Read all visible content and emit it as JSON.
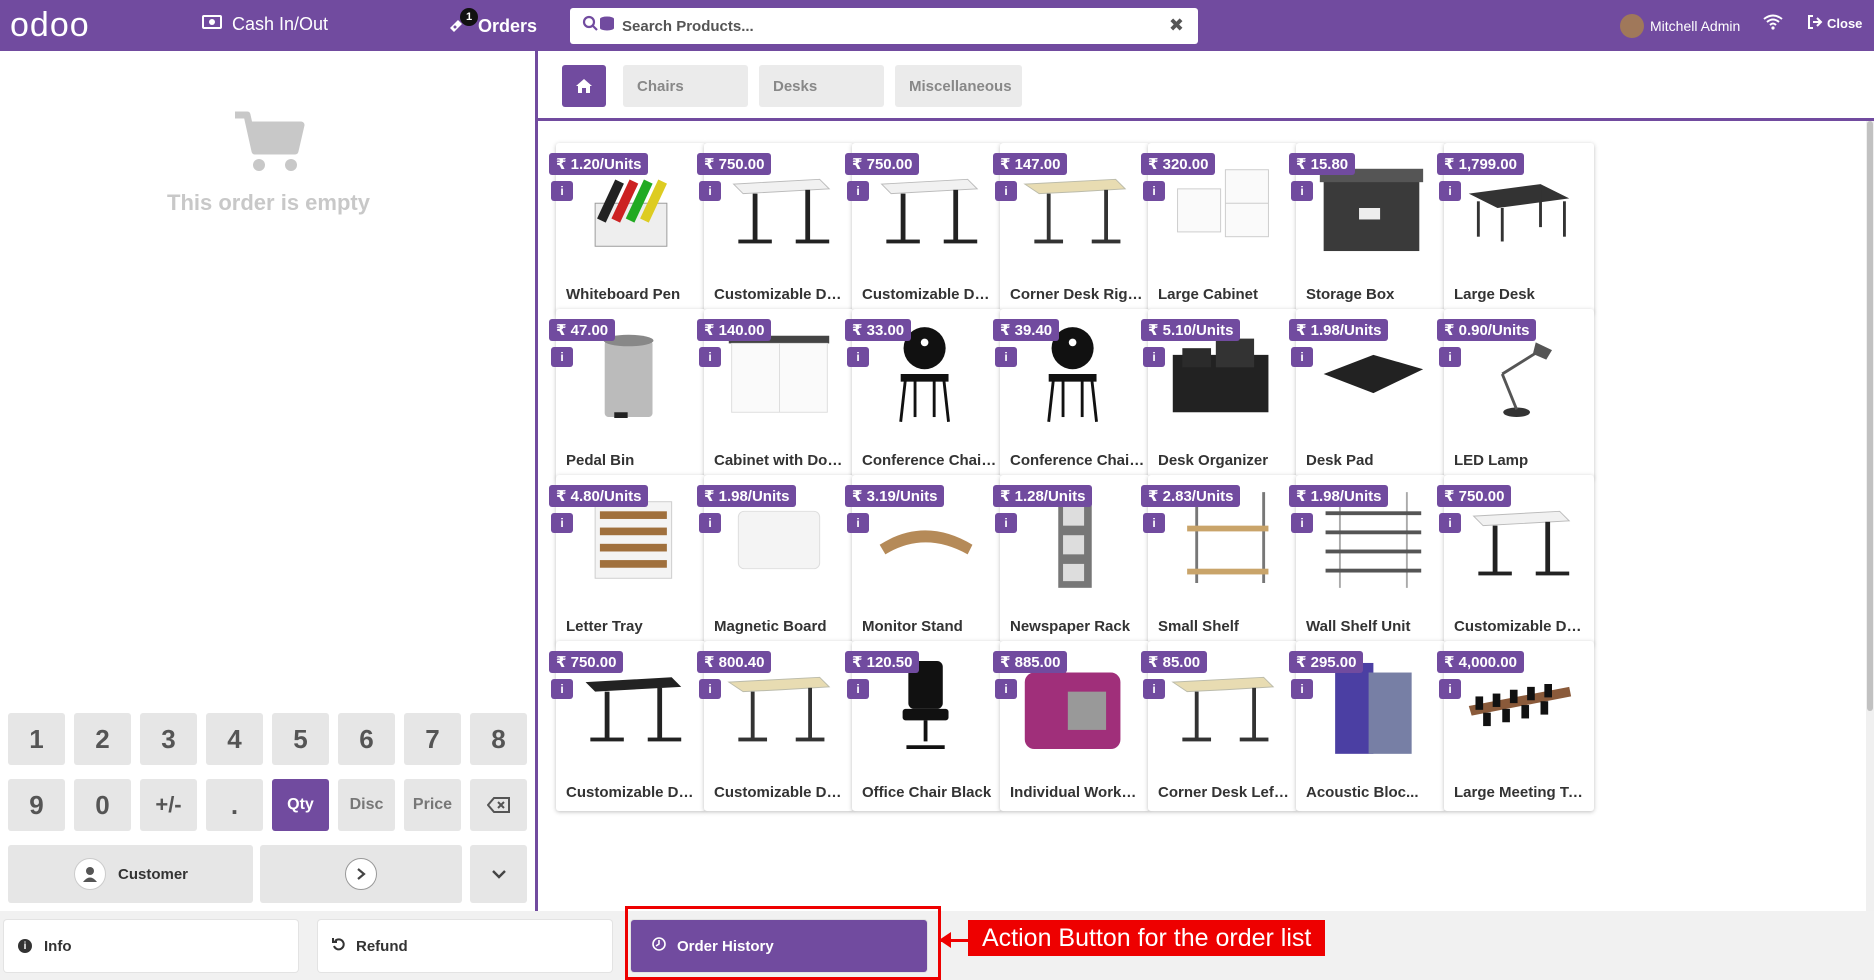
{
  "topbar": {
    "logo": "odoo",
    "cash_label": "Cash In/Out",
    "orders_label": "Orders",
    "orders_badge": "1",
    "search_placeholder": "Search Products...",
    "user_name": "Mitchell Admin",
    "close_label": "Close",
    "accent": "#714B9F"
  },
  "order": {
    "empty_text": "This order is empty"
  },
  "numpad": {
    "row1": [
      "1",
      "2",
      "3",
      "4",
      "5",
      "6",
      "7",
      "8"
    ],
    "row2": [
      "9",
      "0",
      "+/-",
      ".",
      "Qty",
      "Disc",
      "Price"
    ],
    "customer_label": "Customer"
  },
  "categories": [
    "Chairs",
    "Desks",
    "Miscellaneous"
  ],
  "products": [
    {
      "name": "Whiteboard Pen",
      "price": "₹ 1.20/Units",
      "img": "pens"
    },
    {
      "name": "Customizable Des...",
      "price": "₹ 750.00",
      "img": "desk-white"
    },
    {
      "name": "Customizable Des...",
      "price": "₹ 750.00",
      "img": "desk-white"
    },
    {
      "name": "Corner Desk Right...",
      "price": "₹ 147.00",
      "img": "desk-corner"
    },
    {
      "name": "Large Cabinet",
      "price": "₹ 320.00",
      "img": "cabinet"
    },
    {
      "name": "Storage Box",
      "price": "₹ 15.80",
      "img": "box"
    },
    {
      "name": "Large Desk",
      "price": "₹ 1,799.00",
      "img": "desk-large"
    },
    {
      "name": "Pedal Bin",
      "price": "₹ 47.00",
      "img": "bin"
    },
    {
      "name": "Cabinet with Doors",
      "price": "₹ 140.00",
      "img": "cabinet-doors"
    },
    {
      "name": "Conference Chair...",
      "price": "₹ 33.00",
      "img": "chair"
    },
    {
      "name": "Conference Chair...",
      "price": "₹ 39.40",
      "img": "chair"
    },
    {
      "name": "Desk Organizer",
      "price": "₹ 5.10/Units",
      "img": "organizer"
    },
    {
      "name": "Desk Pad",
      "price": "₹ 1.98/Units",
      "img": "pad"
    },
    {
      "name": "LED Lamp",
      "price": "₹ 0.90/Units",
      "img": "lamp"
    },
    {
      "name": "Letter Tray",
      "price": "₹ 4.80/Units",
      "img": "tray"
    },
    {
      "name": "Magnetic Board",
      "price": "₹ 1.98/Units",
      "img": "board"
    },
    {
      "name": "Monitor Stand",
      "price": "₹ 3.19/Units",
      "img": "stand"
    },
    {
      "name": "Newspaper Rack",
      "price": "₹ 1.28/Units",
      "img": "rack"
    },
    {
      "name": "Small Shelf",
      "price": "₹ 2.83/Units",
      "img": "shelf"
    },
    {
      "name": "Wall Shelf Unit",
      "price": "₹ 1.98/Units",
      "img": "wallshelf"
    },
    {
      "name": "Customizable Des...",
      "price": "₹ 750.00",
      "img": "desk-white"
    },
    {
      "name": "Customizable Des...",
      "price": "₹ 750.00",
      "img": "desk-black"
    },
    {
      "name": "Customizable Des...",
      "price": "₹ 800.40",
      "img": "desk-corner"
    },
    {
      "name": "Office Chair Black",
      "price": "₹ 120.50",
      "img": "office-chair"
    },
    {
      "name": "Individual Workplace",
      "price": "₹ 885.00",
      "img": "workplace"
    },
    {
      "name": "Corner Desk Left Sit",
      "price": "₹ 85.00",
      "img": "desk-corner"
    },
    {
      "name": "Acoustic Bloc...",
      "price": "₹ 295.00",
      "img": "acoustic"
    },
    {
      "name": "Large Meeting Table",
      "price": "₹ 4,000.00",
      "img": "meeting"
    }
  ],
  "bottom": {
    "info_label": "Info",
    "refund_label": "Refund",
    "history_label": "Order History"
  },
  "annotation": {
    "text": "Action Button for the order list"
  }
}
